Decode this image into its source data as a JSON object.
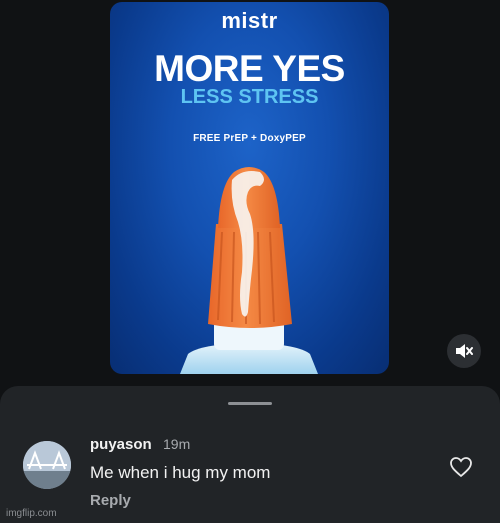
{
  "ad": {
    "brand": "mistr",
    "headline": "MORE YES",
    "subheadline": "LESS STRESS",
    "offer": "FREE PrEP + DoxyPEP"
  },
  "controls": {
    "mute_icon": "speaker-muted-icon"
  },
  "comment": {
    "username": "puyason",
    "time": "19m",
    "text": "Me when i hug my mom",
    "reply_label": "Reply",
    "like_icon": "heart-outline-icon"
  },
  "watermark": "imgflip.com",
  "colors": {
    "background": "#101214",
    "ad_blue": "#1350b0",
    "accent_cyan": "#5ec4f2",
    "product_orange": "#f07a3a",
    "sheet": "#212427"
  }
}
